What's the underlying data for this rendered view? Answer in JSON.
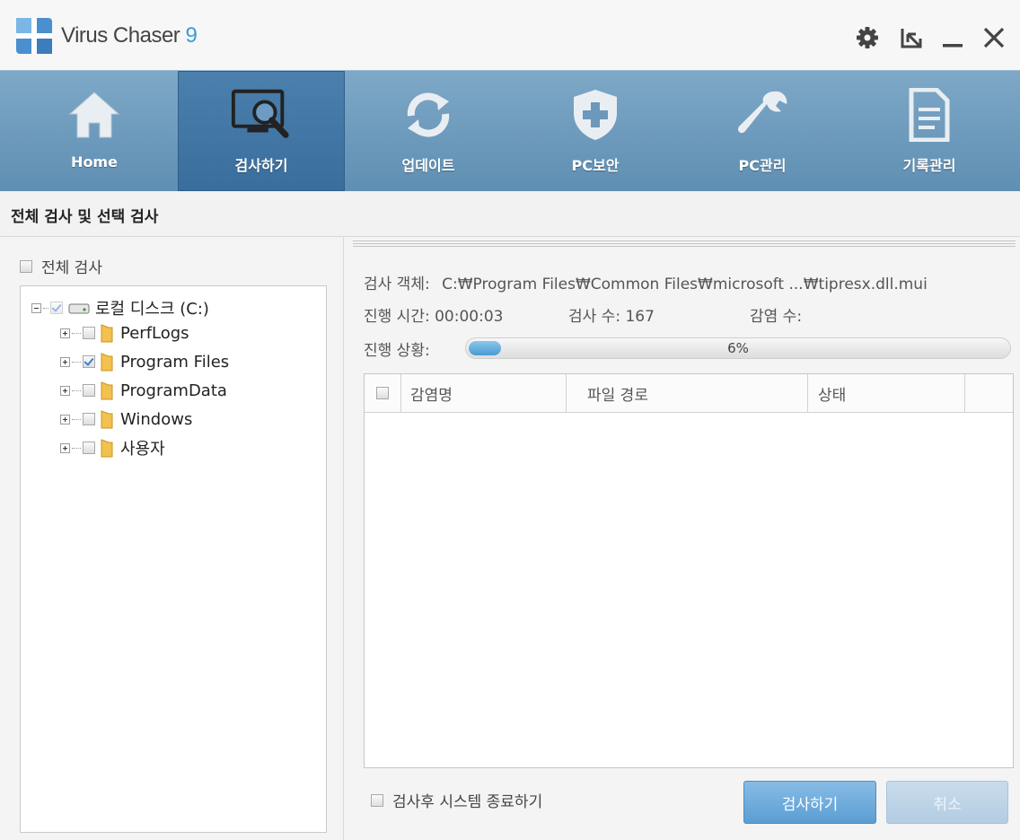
{
  "app": {
    "title": "Virus Chaser",
    "version": "9"
  },
  "window_controls": {
    "settings": "gear-icon",
    "minimize_to_tray": "resize-icon",
    "minimize": "minimize-icon",
    "close": "close-icon"
  },
  "nav": {
    "tabs": [
      {
        "label": "Home",
        "icon": "home-icon",
        "active": false
      },
      {
        "label": "검사하기",
        "icon": "monitor-search-icon",
        "active": true
      },
      {
        "label": "업데이트",
        "icon": "refresh-icon",
        "active": false
      },
      {
        "label": "PC보안",
        "icon": "shield-plus-icon",
        "active": false
      },
      {
        "label": "PC관리",
        "icon": "wrench-icon",
        "active": false
      },
      {
        "label": "기록관리",
        "icon": "document-icon",
        "active": false
      }
    ]
  },
  "section": {
    "title": "전체 검사 및 선택 검사"
  },
  "left": {
    "full_scan_label": "전체 검사",
    "tree": {
      "root": "로컬 디스크 (C:)",
      "children": [
        {
          "label": "PerfLogs",
          "checked": false
        },
        {
          "label": "Program Files",
          "checked": true
        },
        {
          "label": "ProgramData",
          "checked": false
        },
        {
          "label": "Windows",
          "checked": false
        },
        {
          "label": "사용자",
          "checked": false
        }
      ]
    }
  },
  "scan": {
    "object_label": "검사 객체:",
    "object_value": "C:₩Program Files₩Common Files₩microsoft ...₩tipresx.dll.mui",
    "elapsed_label": "진행 시간:",
    "elapsed_value": "00:00:03",
    "count_label": "검사 수:",
    "count_value": "167",
    "infected_label": "감염 수:",
    "infected_value": "",
    "progress_label": "진행 상황:",
    "progress_percent": 6,
    "progress_text": "6%"
  },
  "results": {
    "columns": [
      "감염명",
      "파일 경로",
      "상태"
    ],
    "rows": []
  },
  "footer": {
    "shutdown_label": "검사후 시스템 종료하기",
    "scan_button": "검사하기",
    "cancel_button": "취소"
  },
  "colors": {
    "nav_bg": "#6b98bb",
    "nav_active": "#3f73a2",
    "accent": "#3a9bd8"
  }
}
